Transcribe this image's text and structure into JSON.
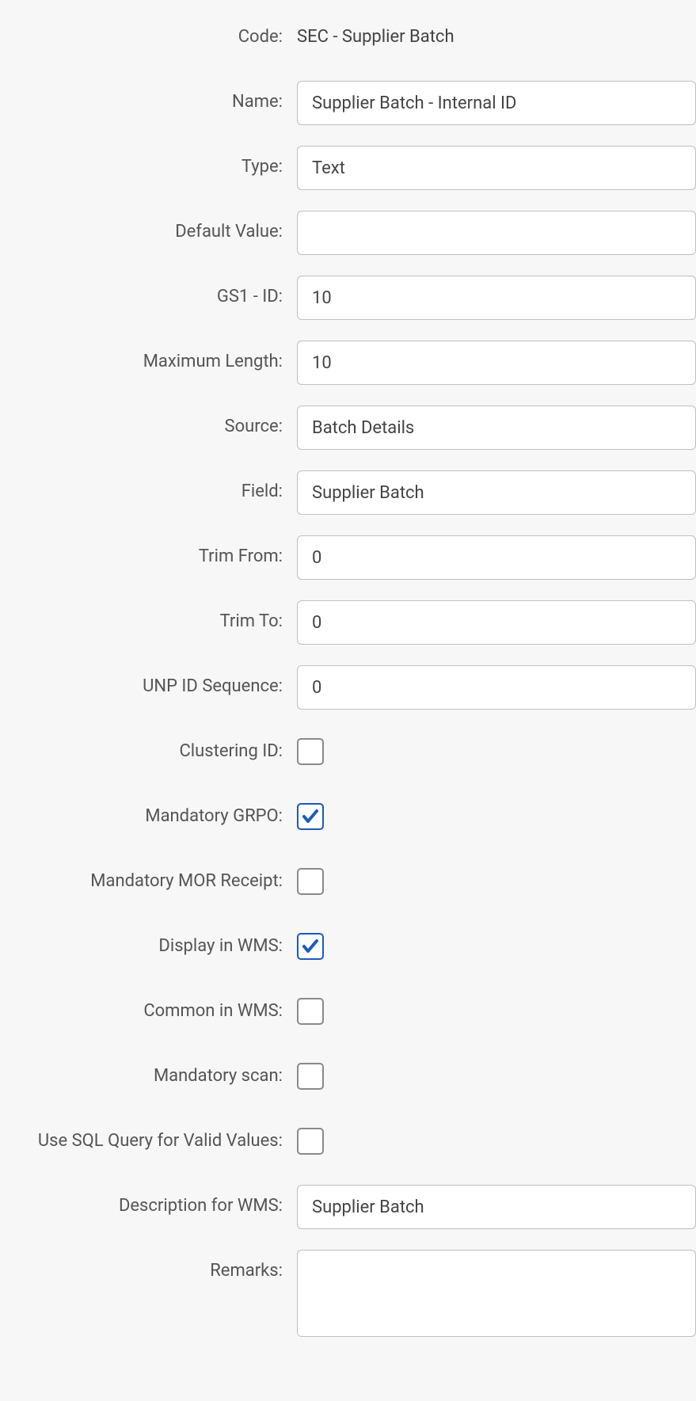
{
  "form": {
    "code": {
      "label": "Code:",
      "value": "SEC - Supplier Batch"
    },
    "name": {
      "label": "Name:",
      "value": "Supplier Batch - Internal ID"
    },
    "type": {
      "label": "Type:",
      "value": "Text"
    },
    "default_value": {
      "label": "Default Value:",
      "value": ""
    },
    "gs1_id": {
      "label": "GS1 - ID:",
      "value": "10"
    },
    "maximum_length": {
      "label": "Maximum Length:",
      "value": "10"
    },
    "source": {
      "label": "Source:",
      "value": "Batch Details"
    },
    "field": {
      "label": "Field:",
      "value": "Supplier Batch"
    },
    "trim_from": {
      "label": "Trim From:",
      "value": "0"
    },
    "trim_to": {
      "label": "Trim To:",
      "value": "0"
    },
    "unp_id_sequence": {
      "label": "UNP ID Sequence:",
      "value": "0"
    },
    "clustering_id": {
      "label": "Clustering ID:",
      "checked": false
    },
    "mandatory_grpo": {
      "label": "Mandatory GRPO:",
      "checked": true
    },
    "mandatory_mor_receipt": {
      "label": "Mandatory MOR Receipt:",
      "checked": false
    },
    "display_in_wms": {
      "label": "Display in WMS:",
      "checked": true
    },
    "common_in_wms": {
      "label": "Common in WMS:",
      "checked": false
    },
    "mandatory_scan": {
      "label": "Mandatory scan:",
      "checked": false
    },
    "use_sql_query": {
      "label": "Use SQL Query for Valid Values:",
      "checked": false
    },
    "description_for_wms": {
      "label": "Description for WMS:",
      "value": "Supplier Batch"
    },
    "remarks": {
      "label": "Remarks:",
      "value": ""
    }
  }
}
